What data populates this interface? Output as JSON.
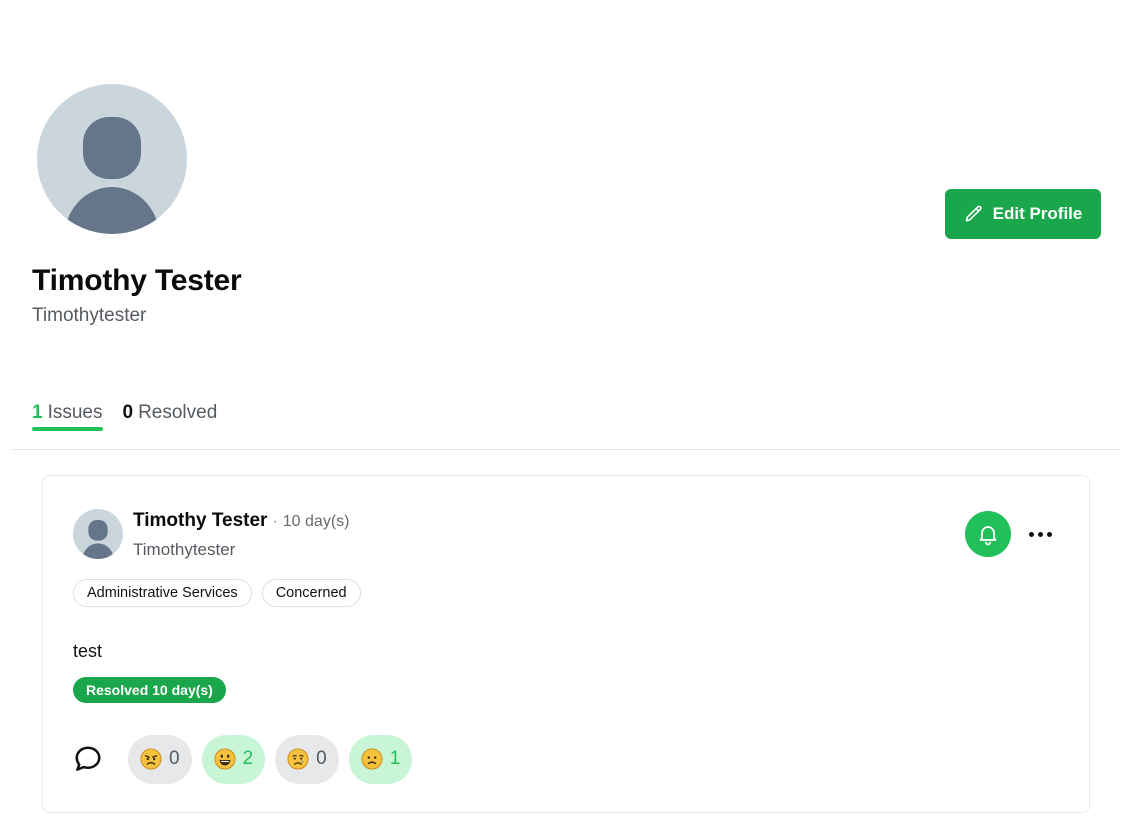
{
  "profile": {
    "name": "Timothy Tester",
    "username": "Timothytester",
    "edit_label": "Edit Profile"
  },
  "tabs": [
    {
      "count": "1",
      "label": "Issues",
      "active": true
    },
    {
      "count": "0",
      "label": "Resolved",
      "active": false
    }
  ],
  "post": {
    "author": "Timothy Tester",
    "separator": "·",
    "time": "10 day(s)",
    "username": "Timothytester",
    "tags": [
      "Administrative Services",
      "Concerned"
    ],
    "body": "test",
    "status": "Resolved 10 day(s)",
    "reactions": [
      {
        "icon": "angry-face-icon",
        "count": "0",
        "active": false
      },
      {
        "icon": "grinning-face-icon",
        "count": "2",
        "active": true
      },
      {
        "icon": "crying-face-icon",
        "count": "0",
        "active": false
      },
      {
        "icon": "worried-face-icon",
        "count": "1",
        "active": true
      }
    ]
  },
  "colors": {
    "accent": "#1aa64b",
    "accent_light": "#22c05a",
    "reaction_on_bg": "#c8f5d6",
    "reaction_off_bg": "#e7e8ea",
    "avatar_bg": "#cbd5dc",
    "avatar_fg": "#65768a"
  }
}
